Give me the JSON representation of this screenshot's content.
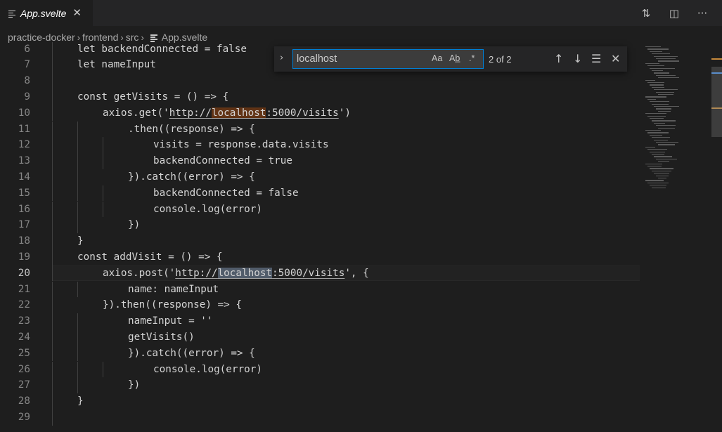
{
  "tab": {
    "title": "App.svelte",
    "close": "✕",
    "icon": "file-lines-icon"
  },
  "toolbar": {
    "compare": "⇅",
    "split": "◫",
    "more": "···"
  },
  "breadcrumb": [
    "practice-docker",
    "frontend",
    "src",
    "App.svelte"
  ],
  "breadcrumb_sep": "›",
  "find": {
    "query": "localhost",
    "expand_glyph": "›",
    "match_case": "Aa",
    "whole_word": "Ab̲",
    "regex": ".*",
    "count": "2 of 2",
    "prev": "↑",
    "next": "↓",
    "in_selection": "☰",
    "close": "✕"
  },
  "code": [
    {
      "n": "6",
      "indent": 1,
      "text": "let backendConnected = false"
    },
    {
      "n": "7",
      "indent": 1,
      "text": "let nameInput"
    },
    {
      "n": "8",
      "indent": 1,
      "text": ""
    },
    {
      "n": "9",
      "indent": 1,
      "text": "const getVisits = () => {"
    },
    {
      "n": "10",
      "indent": 2,
      "pre": "axios.get('",
      "url_a": "http://",
      "match": "localhost",
      "url_b": ":5000/visits",
      "post": "')",
      "match_type": "other"
    },
    {
      "n": "11",
      "indent": 3,
      "text": ".then((response) => {"
    },
    {
      "n": "12",
      "indent": 4,
      "text": "visits = response.data.visits"
    },
    {
      "n": "13",
      "indent": 4,
      "text": "backendConnected = true"
    },
    {
      "n": "14",
      "indent": 3,
      "text": "}).catch((error) => {"
    },
    {
      "n": "15",
      "indent": 4,
      "text": "backendConnected = false"
    },
    {
      "n": "16",
      "indent": 4,
      "text": "console.log(error)"
    },
    {
      "n": "17",
      "indent": 3,
      "text": "})"
    },
    {
      "n": "18",
      "indent": 1,
      "text": "}"
    },
    {
      "n": "19",
      "indent": 1,
      "text": "const addVisit = () => {"
    },
    {
      "n": "20",
      "indent": 2,
      "pre": "axios.post('",
      "url_a": "http://",
      "match": "localhost",
      "url_b": ":5000/visits",
      "post": "', {",
      "match_type": "current"
    },
    {
      "n": "21",
      "indent": 3,
      "text": "name: nameInput"
    },
    {
      "n": "22",
      "indent": 2,
      "text": "}).then((response) => {"
    },
    {
      "n": "23",
      "indent": 3,
      "text": "nameInput = ''"
    },
    {
      "n": "24",
      "indent": 3,
      "text": "getVisits()"
    },
    {
      "n": "25",
      "indent": 3,
      "text": "}).catch((error) => {"
    },
    {
      "n": "26",
      "indent": 4,
      "text": "console.log(error)"
    },
    {
      "n": "27",
      "indent": 3,
      "text": "})"
    },
    {
      "n": "28",
      "indent": 1,
      "text": "}"
    },
    {
      "n": "29",
      "indent": 1,
      "text": ""
    }
  ],
  "current_line": "20",
  "colors": {
    "match_current": "#515c6a",
    "match_other": "#613315",
    "find_border": "#007fd4"
  }
}
